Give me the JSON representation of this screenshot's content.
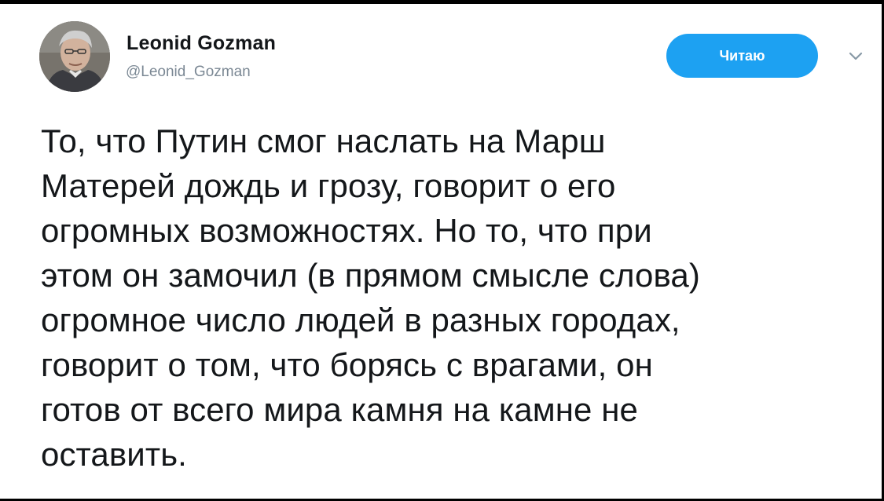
{
  "tweet": {
    "author": {
      "name": "Leonid Gozman",
      "handle": "@Leonid_Gozman"
    },
    "follow_button_label": "Читаю",
    "text_lines": [
      "То, что Путин смог наслать на Марш",
      "Матерей дождь и грозу, говорит о его",
      "огромных возможностях. Но то, что при",
      "этом он замочил (в прямом смысле слова)",
      "огромное число людей в разных городах,",
      "говорит о том, что борясь с врагами, он",
      "готов от всего мира камня на камне не",
      "оставить."
    ]
  },
  "icons": {
    "menu": "chevron-down-icon",
    "avatar": "user-avatar"
  },
  "colors": {
    "accent": "#1da1f2",
    "text": "#14171a",
    "secondary_text": "#7b8894"
  }
}
